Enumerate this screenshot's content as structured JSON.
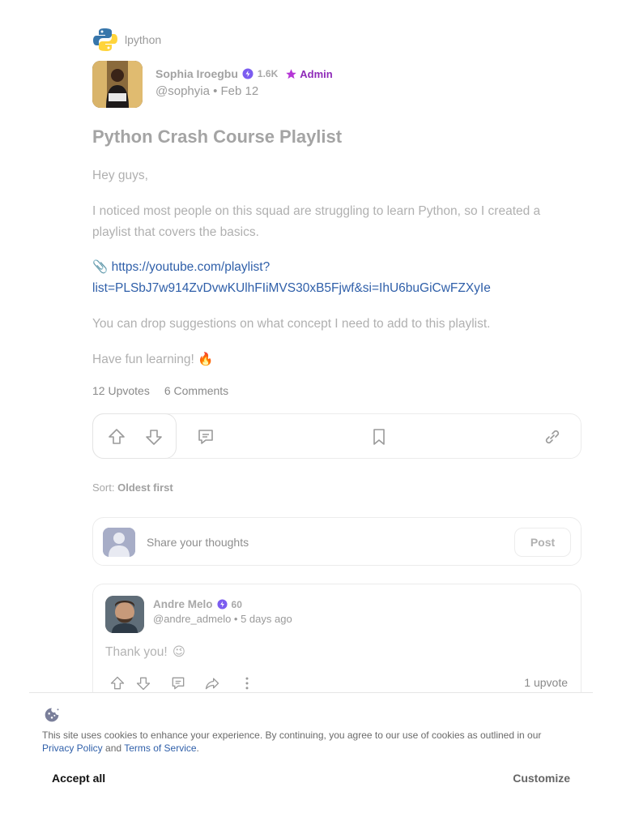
{
  "squad": {
    "name": "lpython",
    "icon": "python-logo-icon"
  },
  "post": {
    "author": {
      "name": "Sophia Iroegbu",
      "reputation": "1.6K",
      "role": "Admin",
      "handle_date": "@sophyia • Feb 12"
    },
    "title": "Python Crash Course Playlist",
    "paragraphs": {
      "greeting": "Hey guys,",
      "intro": "I noticed most people on this squad are struggling to learn Python, so I created a playlist that covers the basics.",
      "link_emoji": "📎",
      "link": "https://youtube.com/playlist?list=PLSbJ7w914ZvDvwKUlhFIiMVS30xB5Fjwf&si=IhU6buGiCwFZXyIe",
      "suggestions": "You can drop suggestions on what concept I need to add to this playlist.",
      "closing": "Have fun learning!",
      "closing_emoji": "🔥"
    },
    "stats": {
      "upvotes": "12 Upvotes",
      "comments": "6 Comments"
    }
  },
  "sort": {
    "label": "Sort:",
    "value": "Oldest first"
  },
  "composer": {
    "placeholder": "Share your thoughts",
    "post_label": "Post"
  },
  "comment": {
    "author": "Andre Melo",
    "reputation": "60",
    "handle_time": "@andre_admelo • 5 days ago",
    "text": "Thank you!",
    "emoji": "😉",
    "upvotes": "1 upvote"
  },
  "cookie": {
    "text": "This site uses cookies to enhance your experience. By continuing, you agree to our use of cookies as outlined in our",
    "privacy": "Privacy Policy",
    "and": "and",
    "terms": "Terms of Service",
    "period": ".",
    "accept": "Accept all",
    "customize": "Customize"
  },
  "colors": {
    "admin": "#8e2ab8",
    "link": "#2f5fa9",
    "verified": "#7b5cf0"
  }
}
